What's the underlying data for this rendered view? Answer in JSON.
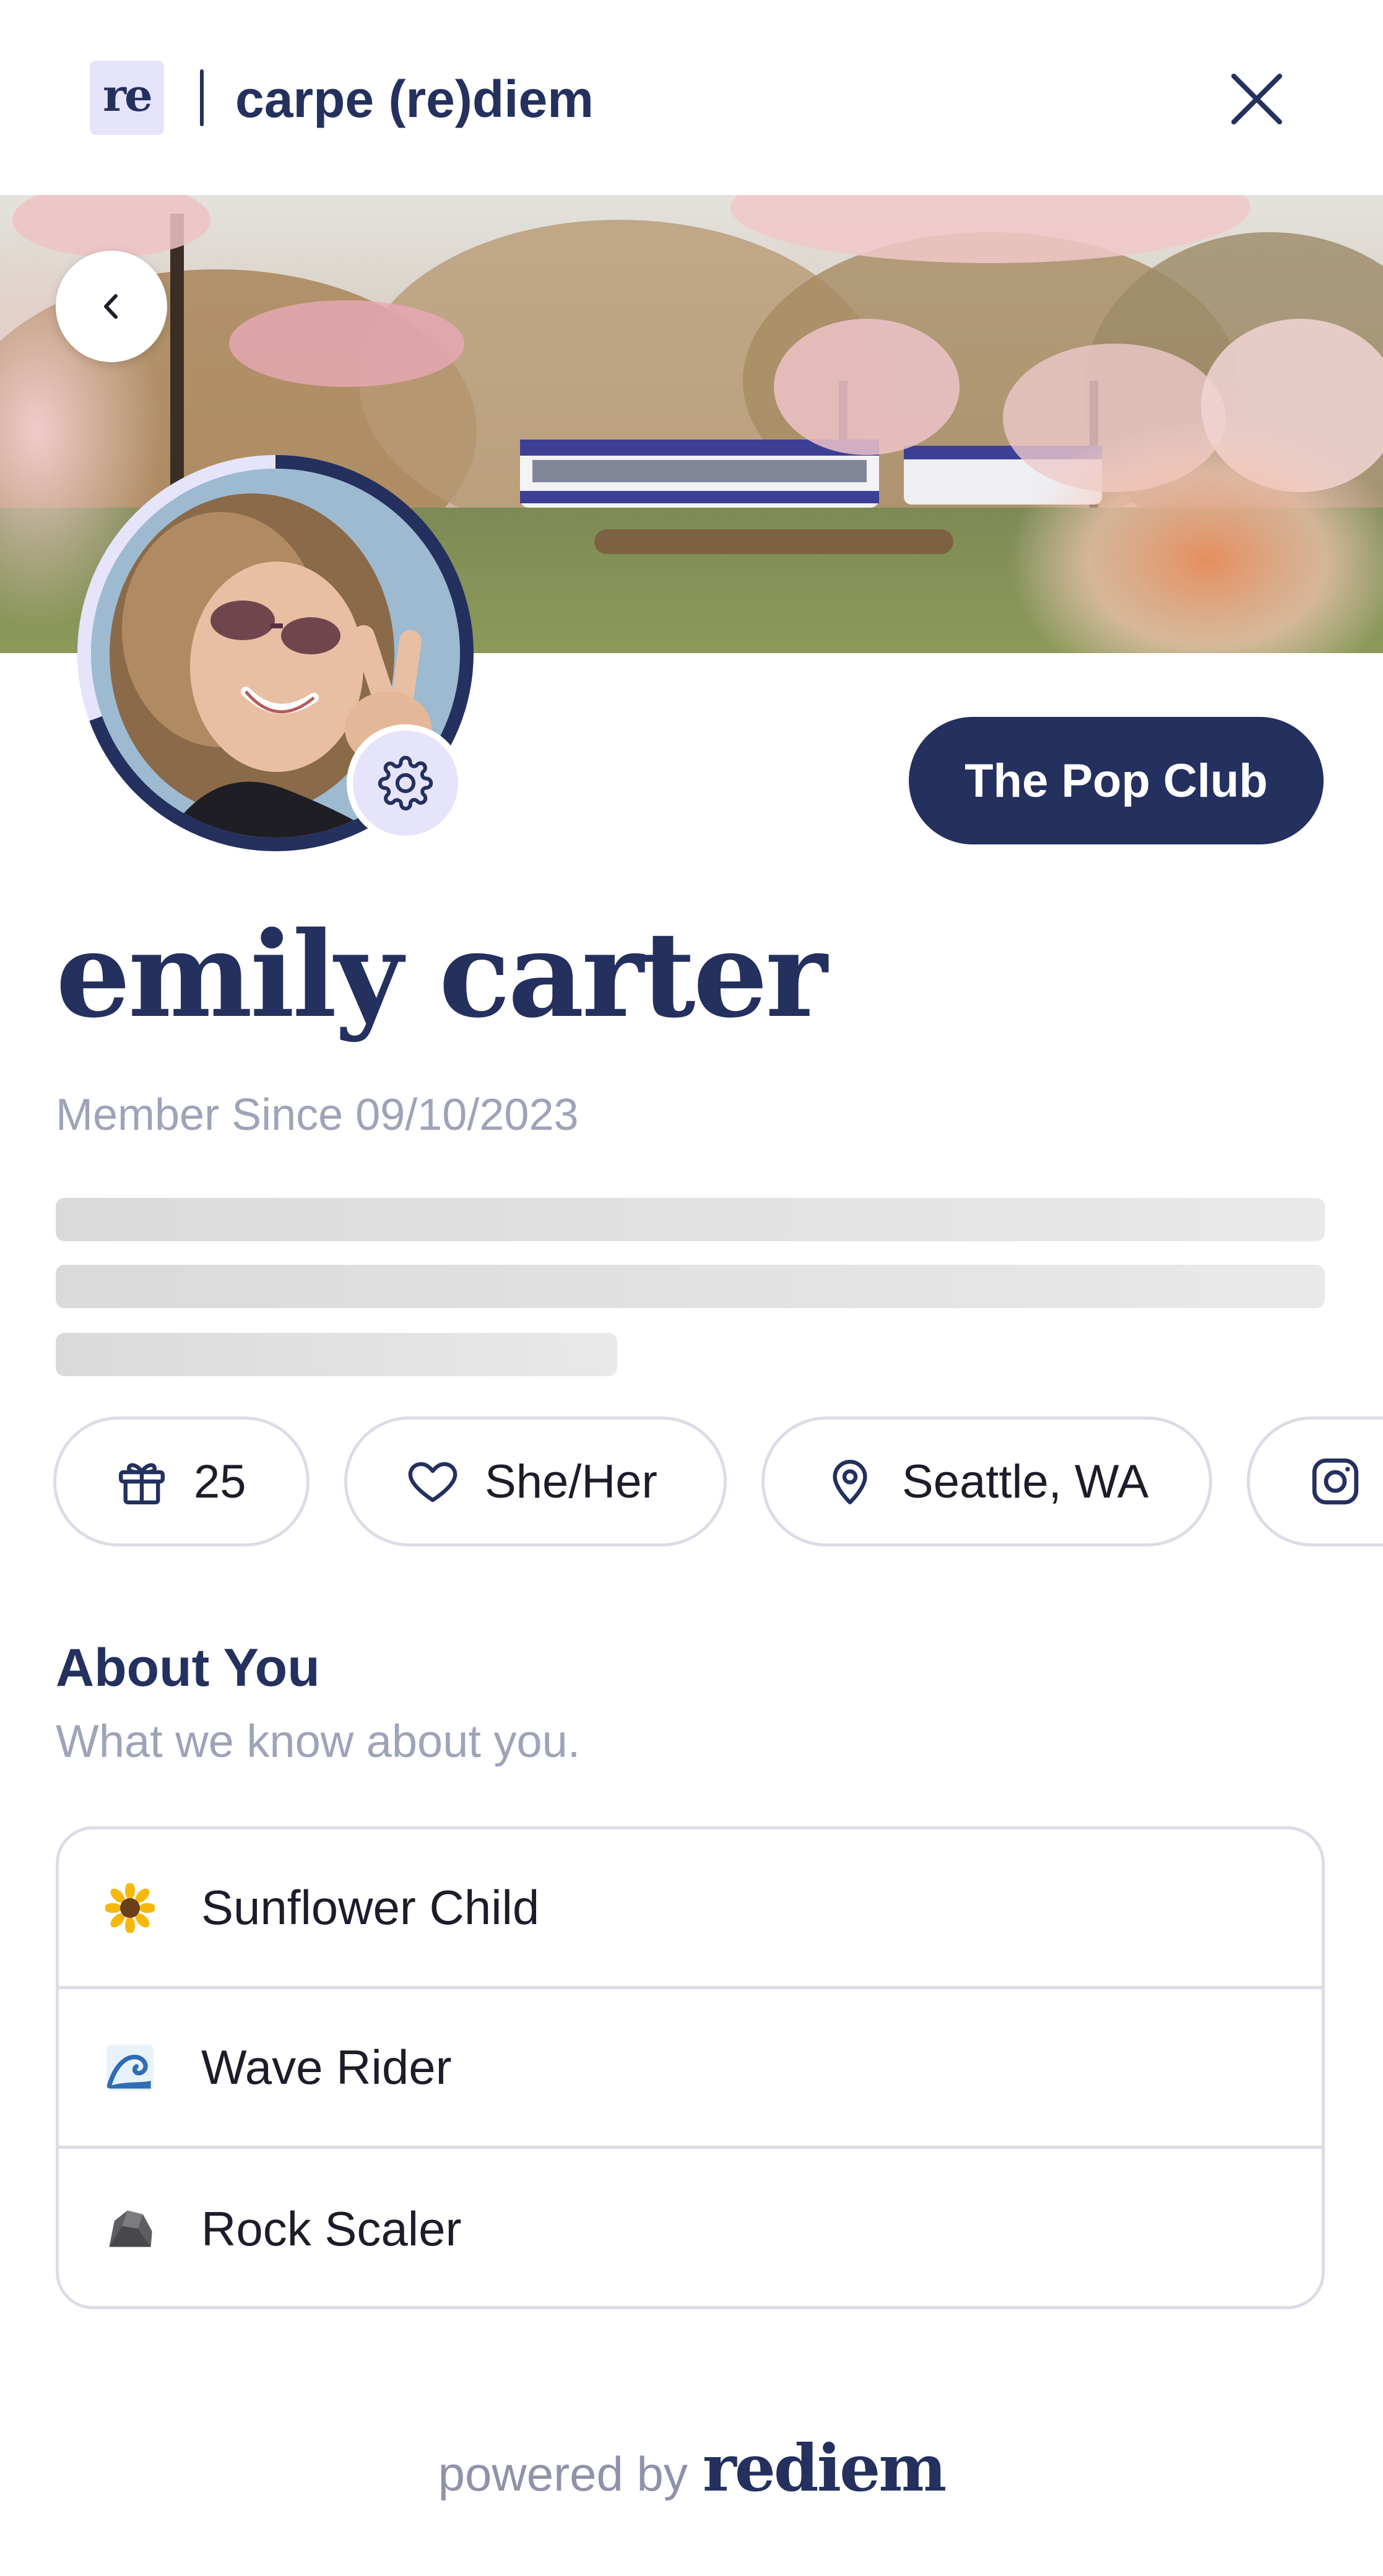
{
  "header": {
    "logo_text": "re",
    "brand_title": "carpe (re)diem"
  },
  "profile": {
    "club_label": "The Pop Club",
    "name": "emily carter",
    "member_since": "Member Since 09/10/2023"
  },
  "chips": [
    {
      "icon": "gift-icon",
      "label": "25"
    },
    {
      "icon": "heart-icon",
      "label": "She/Her"
    },
    {
      "icon": "location-pin-icon",
      "label": "Seattle, WA"
    },
    {
      "icon": "instagram-icon",
      "label": ""
    }
  ],
  "about": {
    "title": "About You",
    "subtitle": "What we know about you.",
    "traits": [
      {
        "icon": "sunflower-icon",
        "label": "Sunflower Child"
      },
      {
        "icon": "wave-icon",
        "label": "Wave Rider"
      },
      {
        "icon": "rock-icon",
        "label": "Rock Scaler"
      }
    ]
  },
  "footer": {
    "powered_by": "powered by",
    "brand": "rediem"
  },
  "colors": {
    "primary": "#24305e",
    "accent_light": "#e6e4fa",
    "muted_text": "#9ea3b8",
    "border": "#dcdce8"
  }
}
